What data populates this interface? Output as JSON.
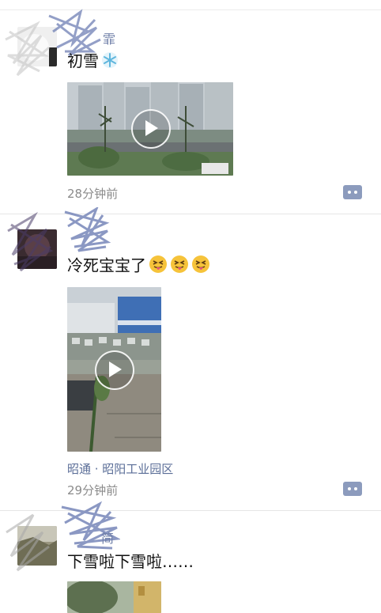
{
  "posts": [
    {
      "name": "霏",
      "text": "初雪",
      "time": "28分钟前",
      "location": ""
    },
    {
      "name": "",
      "text": "冷死宝宝了",
      "time": "29分钟前",
      "location": "昭通 · 昭阳工业园区"
    },
    {
      "name": "简",
      "text": "下雪啦下雪啦……",
      "time": "",
      "location": ""
    }
  ],
  "icons": {
    "snowflake": "snowflake-emoji-icon",
    "tongue": "tongue-out-emoji-icon",
    "play": "play-icon",
    "comment": "comment-icon"
  },
  "colors": {
    "link": "#5a6d97",
    "time": "#8b8b8b",
    "comment_button": "#8c9bbd",
    "divider": "#e6e6e6"
  }
}
